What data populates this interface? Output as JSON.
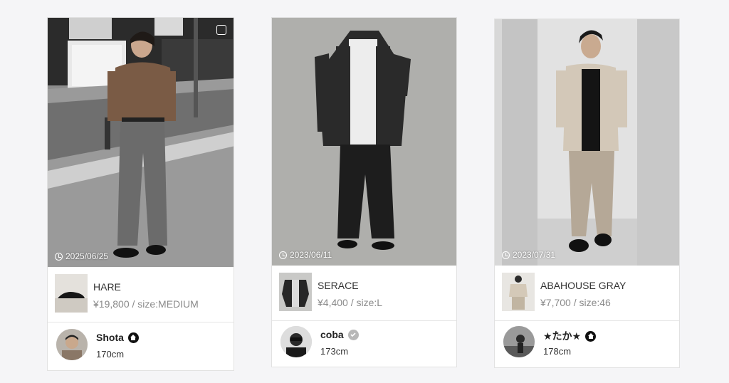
{
  "cards": [
    {
      "date": "2025/06/25",
      "item": {
        "brand": "HARE",
        "price": "¥19,800 / size:MEDIUM"
      },
      "user": {
        "name": "Shota",
        "height": "170cm",
        "badge": "home-icon"
      }
    },
    {
      "date": "2023/06/11",
      "item": {
        "brand": "SERACE",
        "price": "¥4,400 / size:L"
      },
      "user": {
        "name": "coba",
        "height": "173cm",
        "badge": "verified-check-icon"
      }
    },
    {
      "date": "2023/07/31",
      "item": {
        "brand": "ABAHOUSE GRAY",
        "price": "¥7,700 / size:46"
      },
      "user": {
        "name": "★たか★",
        "height": "178cm",
        "badge": "home-icon"
      }
    }
  ]
}
